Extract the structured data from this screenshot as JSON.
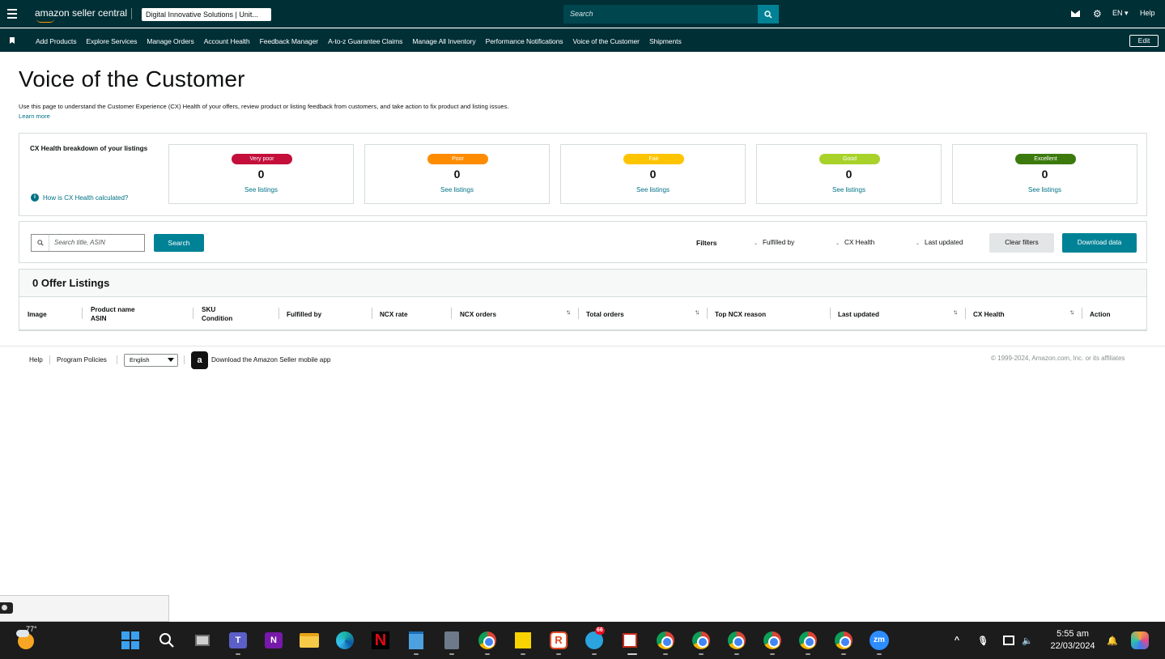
{
  "header": {
    "logo_text": "amazon seller central",
    "account": "Digital Innovative Solutions | Unit...",
    "search_placeholder": "Search",
    "language": "EN",
    "help": "Help"
  },
  "nav": {
    "items": [
      "Add Products",
      "Explore Services",
      "Manage Orders",
      "Account Health",
      "Feedback Manager",
      "A-to-z Guarantee Claims",
      "Manage All Inventory",
      "Performance Notifications",
      "Voice of the Customer",
      "Shipments"
    ],
    "edit": "Edit"
  },
  "page": {
    "title": "Voice of the Customer",
    "description": "Use this page to understand the Customer Experience (CX) Health of your offers, review product or listing feedback from customers, and take action to fix product and listing issues.",
    "learn_more": "Learn more"
  },
  "health": {
    "title": "CX Health breakdown of your listings",
    "how_link": "How is CX Health calculated?",
    "cards": [
      {
        "label": "Very poor",
        "count": "0",
        "link": "See listings",
        "color": "#c40f3b"
      },
      {
        "label": "Poor",
        "count": "0",
        "link": "See listings",
        "color": "#ff8c00"
      },
      {
        "label": "Fair",
        "count": "0",
        "link": "See listings",
        "color": "#ffc400"
      },
      {
        "label": "Good",
        "count": "0",
        "link": "See listings",
        "color": "#a8d22a"
      },
      {
        "label": "Excellent",
        "count": "0",
        "link": "See listings",
        "color": "#3c7a0e"
      }
    ]
  },
  "filters": {
    "search_placeholder": "Search title, ASIN",
    "search_button": "Search",
    "label": "Filters",
    "dropdowns": [
      "Fulfilled by",
      "CX Health",
      "Last updated"
    ],
    "clear": "Clear filters",
    "download": "Download data"
  },
  "table": {
    "title": "0 Offer Listings",
    "columns": [
      {
        "line1": "Image",
        "line2": ""
      },
      {
        "line1": "Product name",
        "line2": "ASIN"
      },
      {
        "line1": "SKU",
        "line2": "Condition"
      },
      {
        "line1": "Fulfilled by",
        "line2": ""
      },
      {
        "line1": "NCX rate",
        "line2": ""
      },
      {
        "line1": "NCX orders",
        "line2": ""
      },
      {
        "line1": "Total orders",
        "line2": ""
      },
      {
        "line1": "Top NCX reason",
        "line2": ""
      },
      {
        "line1": "Last updated",
        "line2": ""
      },
      {
        "line1": "CX Health",
        "line2": ""
      },
      {
        "line1": "Action",
        "line2": ""
      }
    ]
  },
  "footer": {
    "help": "Help",
    "policies": "Program Policies",
    "language": "English",
    "app_text": "Download the Amazon Seller mobile app",
    "copyright": "© 1999-2024, Amazon.com, Inc. or its affiliates"
  },
  "taskbar": {
    "temperature": "77°",
    "time": "5:55 am",
    "date": "22/03/2024",
    "telegram_badge": "66"
  },
  "colors": {
    "header_bg": "#002f36",
    "accent": "#008296",
    "link": "#007185"
  }
}
